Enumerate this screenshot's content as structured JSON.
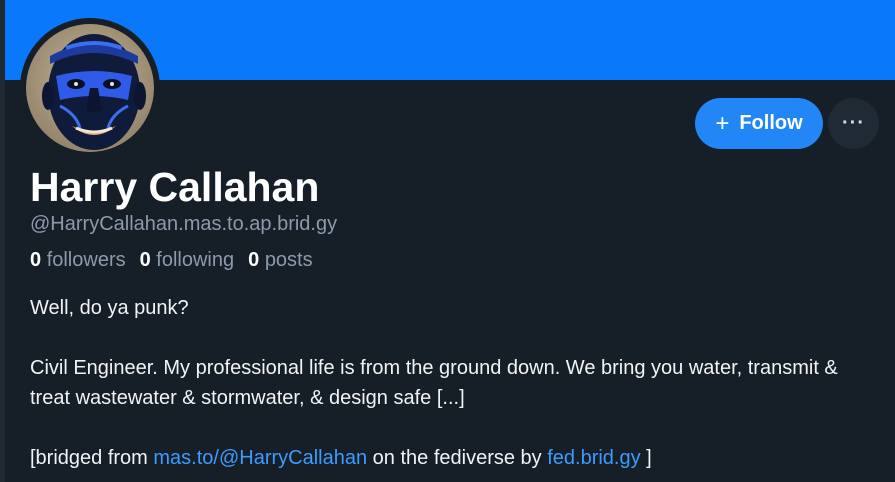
{
  "colors": {
    "banner": "#0a78fb",
    "background": "#161e27",
    "follow_button": "#2286f6",
    "link": "#3b9cff"
  },
  "profile": {
    "avatar_icon": "carved-mask-avatar",
    "display_name": "Harry Callahan",
    "handle": "@HarryCallahan.mas.to.ap.brid.gy",
    "stats": {
      "followers_count": "0",
      "followers_label": "followers",
      "following_count": "0",
      "following_label": "following",
      "posts_count": "0",
      "posts_label": "posts"
    }
  },
  "actions": {
    "follow_icon": "plus-icon",
    "follow_label": "Follow",
    "more_icon": "ellipsis-icon",
    "more_label": "···"
  },
  "bio": {
    "line1": "Well, do ya punk?",
    "line2": "Civil Engineer. My professional life is from the ground down. We bring you water, transmit & treat wastewater & stormwater, & design safe [...]",
    "bridged_prefix": "[bridged from ",
    "bridged_source_link": "mas.to/@HarryCallahan",
    "bridged_middle": " on the fediverse by ",
    "bridged_bridge_link": "fed.brid.gy",
    "bridged_suffix": " ]"
  }
}
